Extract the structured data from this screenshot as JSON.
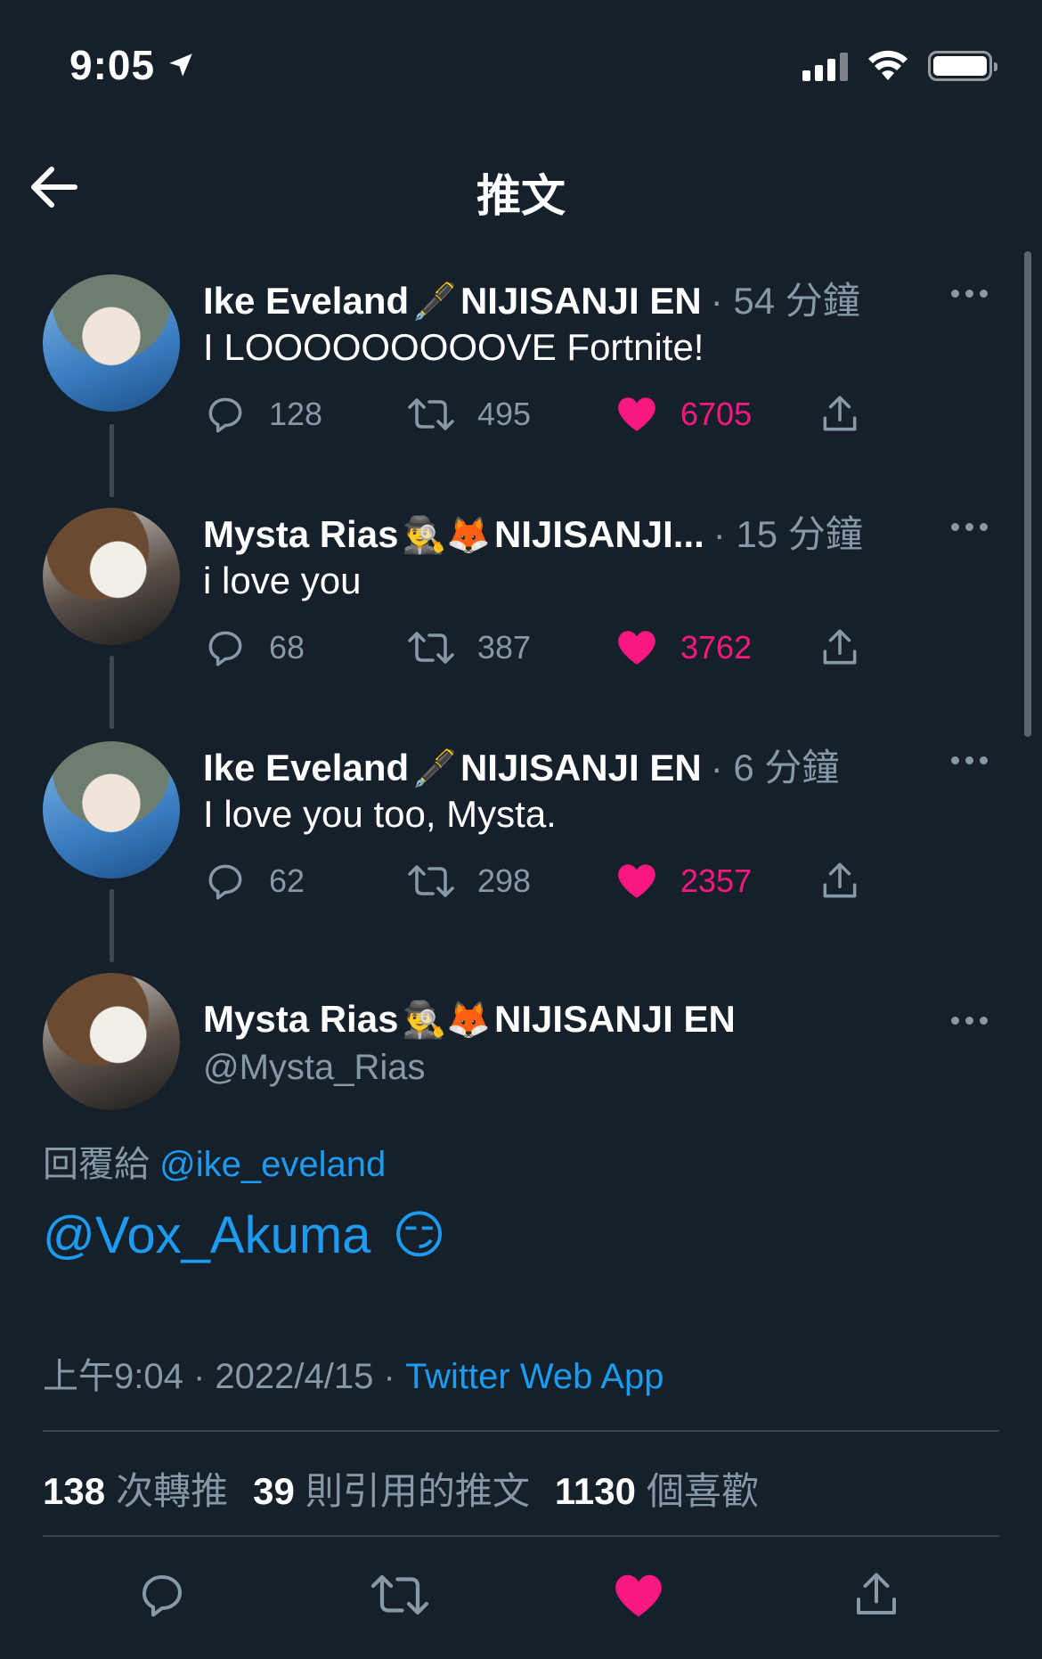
{
  "status_bar": {
    "time": "9:05"
  },
  "nav": {
    "title": "推文"
  },
  "thread": [
    {
      "name": "Ike Eveland",
      "emoji": "🖋️",
      "affiliation": "NIJISANJI EN",
      "time": "· 54 分鐘",
      "text": "I LOOOOOOOOOVE Fortnite!",
      "replies": "128",
      "retweets": "495",
      "likes": "6705"
    },
    {
      "name": "Mysta Rias",
      "emoji": "🕵️‍♂️🦊",
      "affiliation": "NIJISANJI...",
      "time": "· 15 分鐘",
      "text": "i love you",
      "replies": "68",
      "retweets": "387",
      "likes": "3762"
    },
    {
      "name": "Ike Eveland",
      "emoji": "🖋️",
      "affiliation": "NIJISANJI EN",
      "time": "· 6 分鐘",
      "text": "I love you too, Mysta.",
      "replies": "62",
      "retweets": "298",
      "likes": "2357"
    }
  ],
  "main_tweet": {
    "name": "Mysta Rias",
    "emoji": "🕵️‍♂️🦊",
    "affiliation": "NIJISANJI EN",
    "handle": "@Mysta_Rias",
    "reply_prefix": "回覆給",
    "reply_to": "@ike_eveland",
    "text": "@Vox_Akuma",
    "text_emoji": "😏",
    "time": "上午9:04",
    "date": "2022/4/15",
    "source": "Twitter Web App",
    "retweets_count": "138",
    "retweets_label": "次轉推",
    "quotes_count": "39",
    "quotes_label": "則引用的推文",
    "likes_count": "1130",
    "likes_label": "個喜歡"
  },
  "colors": {
    "background": "#15202b",
    "accent": "#1d9bf0",
    "like": "#f91880",
    "muted": "#8899a6"
  }
}
